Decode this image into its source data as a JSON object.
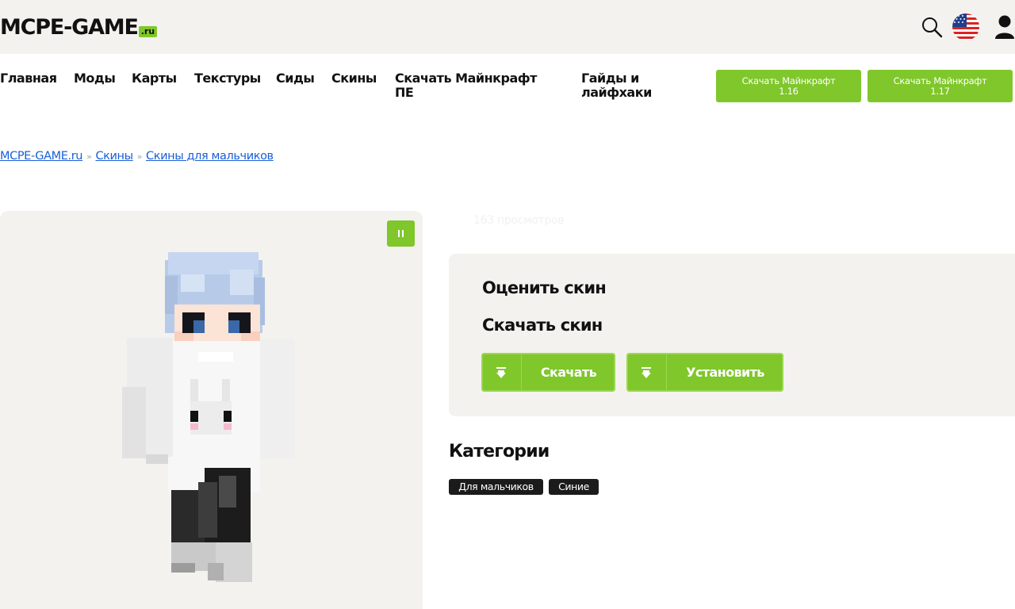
{
  "header": {
    "logo_text": "MCPE-GAME",
    "logo_suffix": ".ru"
  },
  "nav": {
    "items": [
      {
        "label": "Главная"
      },
      {
        "label": "Моды"
      },
      {
        "label": "Карты"
      },
      {
        "label": "Текстуры"
      },
      {
        "label": "Сиды"
      },
      {
        "label": "Скины"
      },
      {
        "label_line1": "Скачать Майнкрафт",
        "label_line2": "ПЕ"
      },
      {
        "label_line1": "Гайды и",
        "label_line2": "лайфхаки"
      }
    ],
    "buttons": [
      {
        "line1": "Скачать Майнкрафт",
        "line2": "1.16"
      },
      {
        "line1": "Скачать Майнкрафт",
        "line2": "1.17"
      }
    ]
  },
  "breadcrumb": {
    "items": [
      "MCPE-GAME.ru",
      "Скины",
      "Скины для мальчиков"
    ],
    "separator": "»"
  },
  "skin": {
    "views": "163 просмотров",
    "rate_title": "Оценить скин",
    "download_title": "Скачать скин",
    "download_button": "Скачать",
    "install_button": "Установить"
  },
  "categories": {
    "title": "Категории",
    "tags": [
      "Для мальчиков",
      "Синие"
    ]
  },
  "colors": {
    "accent": "#7fc72a",
    "header_bg": "#f4f2ee",
    "link": "#1a5fd6",
    "tag_bg": "#1b1b1b"
  },
  "icons": [
    "search-icon",
    "us-flag-icon",
    "user-icon",
    "pause-icon",
    "download-icon",
    "install-icon"
  ]
}
